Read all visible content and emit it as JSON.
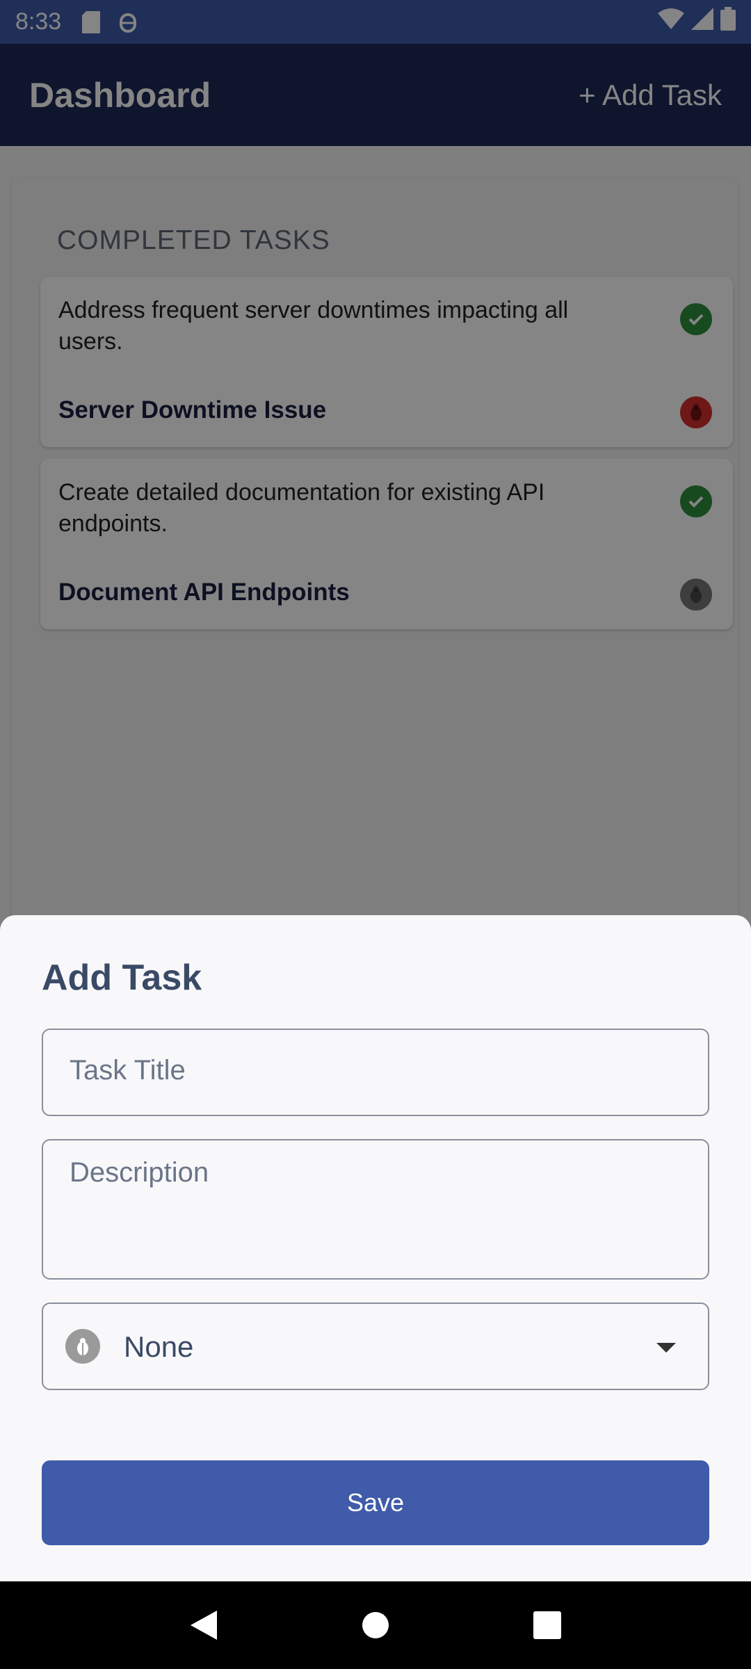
{
  "status_bar": {
    "time": "8:33",
    "icons": [
      "sd-card-icon",
      "bug-icon",
      "wifi-icon",
      "signal-icon",
      "battery-icon"
    ]
  },
  "app_bar": {
    "title": "Dashboard",
    "add_task_label": "+ Add Task"
  },
  "section": {
    "title": "COMPLETED TASKS",
    "tasks": [
      {
        "description": "Address frequent server downtimes impacting all users.",
        "title": "Server Downtime Issue",
        "status_icon": "check-circle-icon",
        "priority_icon": "bug-icon",
        "priority_color": "#d32f2f"
      },
      {
        "description": "Create detailed documentation for existing API endpoints.",
        "title": "Document API Endpoints",
        "status_icon": "check-circle-icon",
        "priority_icon": "bug-icon",
        "priority_color": "#777777"
      }
    ]
  },
  "sheet": {
    "title": "Add Task",
    "title_field": {
      "placeholder": "Task Title",
      "value": ""
    },
    "description_field": {
      "placeholder": "Description",
      "value": ""
    },
    "priority_select": {
      "value": "None",
      "icon": "bug-icon"
    },
    "save_label": "Save"
  },
  "colors": {
    "primary": "#3f5ba9",
    "app_bar": "#1c2a55",
    "success": "#2f8f3c"
  }
}
